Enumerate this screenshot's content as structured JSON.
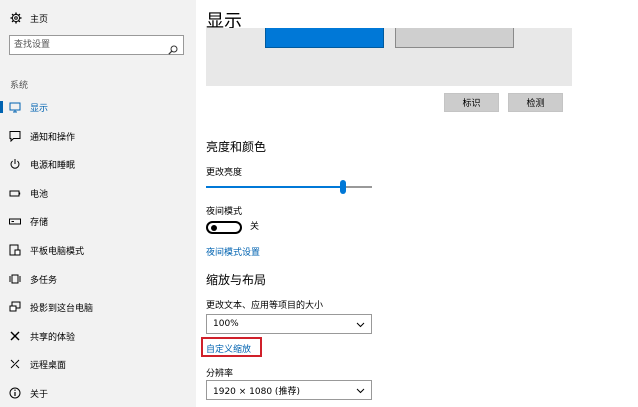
{
  "sidebar": {
    "home_label": "主页",
    "search_placeholder": "查找设置",
    "section_label": "系统",
    "items": [
      {
        "label": "显示",
        "icon": "monitor-icon",
        "active": true
      },
      {
        "label": "通知和操作",
        "icon": "message-icon",
        "active": false
      },
      {
        "label": "电源和睡眠",
        "icon": "power-icon",
        "active": false
      },
      {
        "label": "电池",
        "icon": "battery-icon",
        "active": false
      },
      {
        "label": "存储",
        "icon": "storage-icon",
        "active": false
      },
      {
        "label": "平板电脑模式",
        "icon": "tablet-icon",
        "active": false
      },
      {
        "label": "多任务",
        "icon": "multitask-icon",
        "active": false
      },
      {
        "label": "投影到这台电脑",
        "icon": "project-icon",
        "active": false
      },
      {
        "label": "共享的体验",
        "icon": "shared-icon",
        "active": false
      },
      {
        "label": "远程桌面",
        "icon": "remote-icon",
        "active": false
      },
      {
        "label": "关于",
        "icon": "info-icon",
        "active": false
      }
    ]
  },
  "main": {
    "title": "显示",
    "identify_label": "标识",
    "detect_label": "检测",
    "brightness_heading": "亮度和颜色",
    "brightness_label": "更改亮度",
    "brightness_value": 0.84,
    "night_light_label": "夜间模式",
    "night_light_state": "关",
    "night_light_settings_link": "夜间模式设置",
    "scale_heading": "缩放与布局",
    "scale_label": "更改文本、应用等项目的大小",
    "scale_value": "100%",
    "custom_scaling_link": "自定义缩放",
    "resolution_label": "分辨率",
    "resolution_value": "1920 × 1080 (推荐)"
  },
  "colors": {
    "accent": "#0078d7",
    "link": "#0063b1",
    "highlight_border": "#d0202a",
    "sidebar_bg": "#f2f2f2"
  }
}
